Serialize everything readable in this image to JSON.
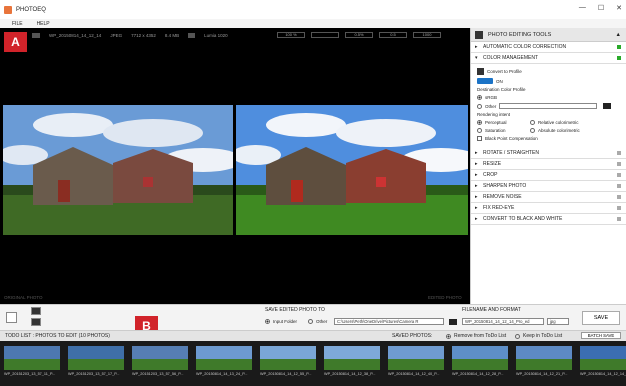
{
  "window": {
    "title": "PHOTOEQ"
  },
  "menu": [
    "FILE",
    "HELP"
  ],
  "viewer": {
    "file_name": "WP_20150814_14_12_14",
    "format": "JPEG",
    "dimensions": "7712 x 4352",
    "size": "8.4 MB",
    "device": "Lumia 1020",
    "zoom": [
      "100 %",
      "",
      "0.5%",
      "0.5",
      "1000"
    ],
    "original_label": "ORIGINAL PHOTO",
    "edited_label": "EDITED PHOTO"
  },
  "badges": {
    "a": "A",
    "b": "B"
  },
  "side": {
    "title": "PHOTO EDITING TOOLS",
    "auto_color": "AUTOMATIC COLOR CORRECTION",
    "color_management": "COLOR MANAGEMENT",
    "convert_label": "Convert to Profile",
    "toggle_text": "ON",
    "dest_label": "Destination Color Profile",
    "srgb": "sRGB",
    "other": "Other",
    "intent_label": "Rendering intent",
    "perceptual": "Perceptual",
    "relative": "Relative colorimetric",
    "saturation": "Saturation",
    "absolute": "Absolute colorimetric",
    "bpc": "Black Point Compensation",
    "tools": [
      "ROTATE / STRAIGHTEN",
      "RESIZE",
      "CROP",
      "SHARPEN PHOTO",
      "REMOVE NOISE",
      "FIX RED-EYE",
      "CONVERT TO BLACK AND WHITE"
    ]
  },
  "save": {
    "title": "SAVE EDITED PHOTO TO",
    "input_folder": "Input Folder",
    "other": "Other",
    "path": "C:\\Users\\Peth\\OneDrive\\Pictures\\Camera R",
    "fn_title": "FILENAME AND FORMAT",
    "filename": "WP_20150814_14_12_14_Pro_ed",
    "ext": "jpg",
    "save_btn": "SAVE"
  },
  "todo": {
    "label": "TODO LIST : PHOTOS TO EDIT   (10 PHOTOS)",
    "saved_label": "SAVED PHOTOS:",
    "remove": "Remove from ToDo List",
    "keep": "Keep in ToDo List",
    "batch": "BATCH SAVE"
  },
  "thumbs": [
    {
      "cap": "WP_20151203_13_57_11_P...",
      "sky": "#4d78b0"
    },
    {
      "cap": "WP_20151203_13_57_17_P...",
      "sky": "#3f6fa8"
    },
    {
      "cap": "WP_20151203_13_57_56_P...",
      "sky": "#567eb3"
    },
    {
      "cap": "WP_20150814_14_13_24_P...",
      "sky": "#6d9ad0"
    },
    {
      "cap": "WP_20150814_14_12_55_P...",
      "sky": "#7aa6d6"
    },
    {
      "cap": "WP_20150814_14_12_38_P...",
      "sky": "#7ea9d8"
    },
    {
      "cap": "WP_20150814_14_12_40_P...",
      "sky": "#6f9bd0"
    },
    {
      "cap": "WP_20150814_14_12_28_P...",
      "sky": "#5e8fc8"
    },
    {
      "cap": "WP_20150814_14_12_21_P...",
      "sky": "#5d8ac4"
    },
    {
      "cap": "WP_20150814_14_12_14_P...",
      "sky": "#3b6eb2"
    }
  ]
}
